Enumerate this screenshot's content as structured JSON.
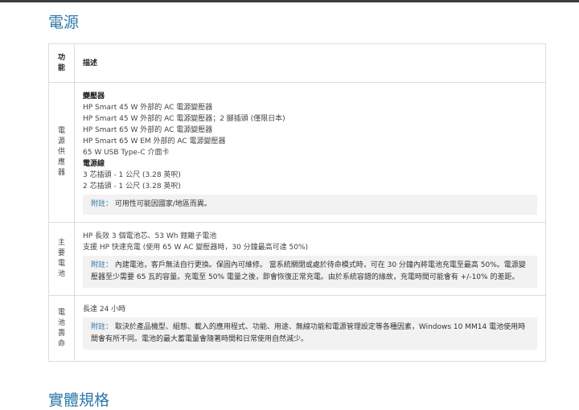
{
  "section_title": "電源",
  "next_section_title": "實體規格",
  "table": {
    "header_function": "功能",
    "header_description": "描述",
    "rows": {
      "power_supply": {
        "feature": "電源供應器",
        "lines": [
          "變壓器",
          "HP Smart 45 W 外部的 AC 電源變壓器",
          "HP Smart 45 W 外部的 AC 電源變壓器；2 腳插頭 (僅限日本)",
          "HP Smart 65 W 外部的 AC 電源變壓器",
          "HP Smart 65 W EM 外部的 AC 電源變壓器",
          "65 W USB Type-C 介面卡",
          "電源線",
          "3 芯插頭 - 1 公尺 (3.28 英呎)",
          "2 芯插頭 - 1 公尺 (3.28 英呎)"
        ],
        "note_label": "附註：",
        "note_text": "可用性可能因國家/地區而異。"
      },
      "primary_battery": {
        "feature": "主要電池",
        "lines": [
          "HP 長效 3 個電池芯、53 Wh 鋰離子電池",
          "支援 HP 快速充電 (使用 65 W AC 變壓器時，30 分鐘最高可達 50%)"
        ],
        "note_label": "附註：",
        "note_text": "內建電池，客戶無法自行更換。保固內可維修。 當系統關閉或處於待命模式時，可在 30 分鐘內將電池充電至最高 50%。電源變壓器至少需要 65 瓦的容量。充電至 50% 電量之後，即會恢復正常充電。由於系統容錯的緣故，充電時間可能會有 +/-10% 的差距。"
      },
      "battery_life": {
        "feature": "電池壽命",
        "lines": [
          "長達 24 小時"
        ],
        "note_label": "附註：",
        "note_text": "取決於產品機型、組態、載入的應用程式、功能、用途、無線功能和電源管理設定等各種因素，Windows 10 MM14 電池使用時間會有所不同。電池的最大蓄電量會隨著時間和日常使用自然減少。"
      }
    }
  }
}
